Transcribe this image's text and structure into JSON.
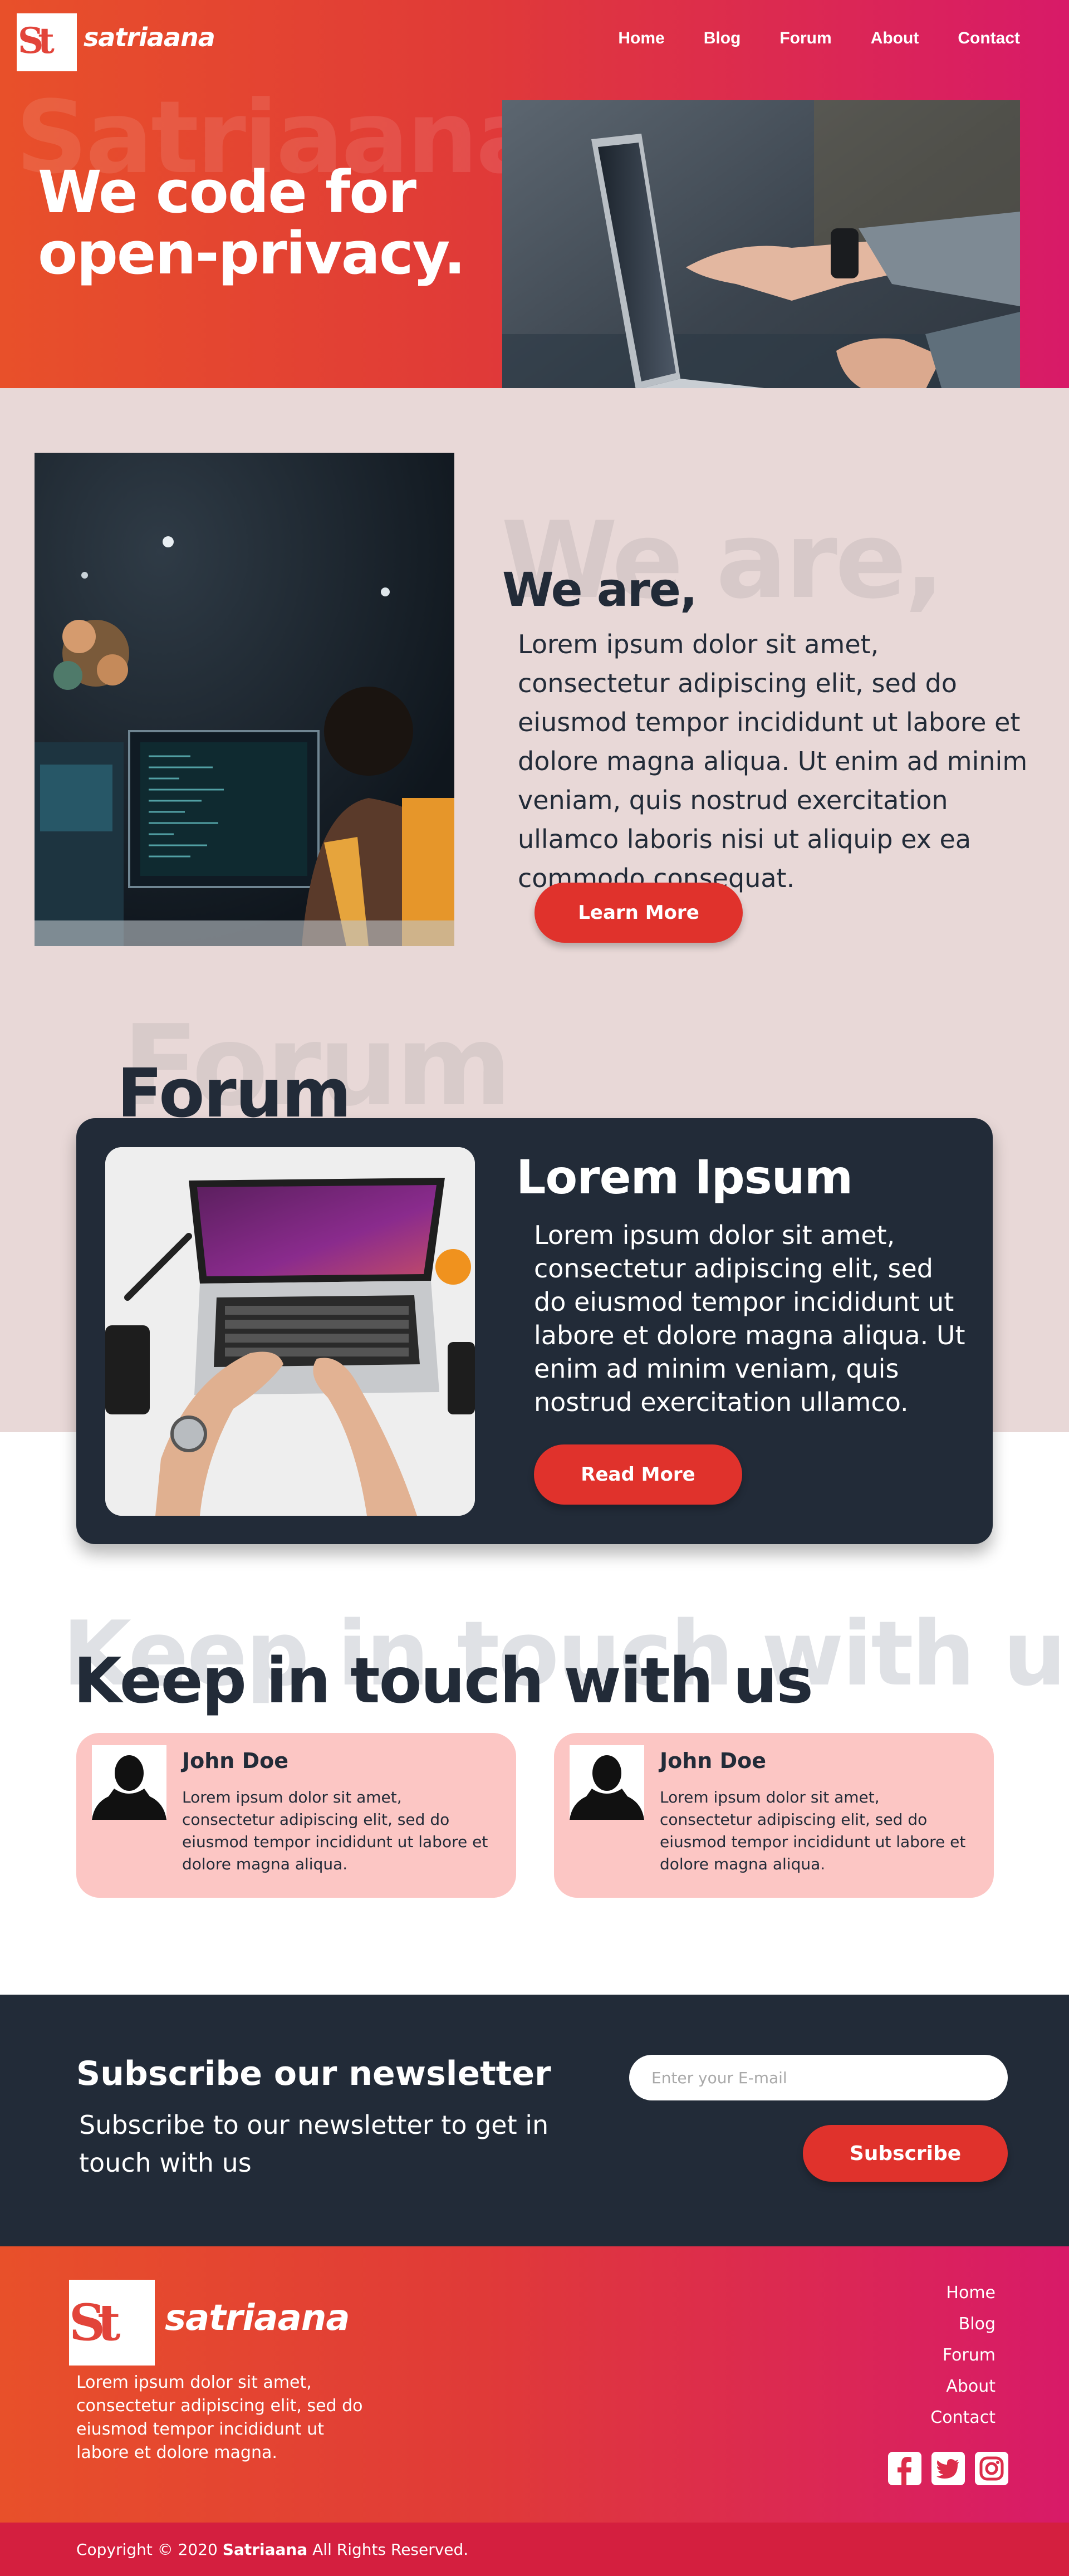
{
  "brand": {
    "name": "satriaana",
    "glyph": "St"
  },
  "nav": {
    "items": [
      "Home",
      "Blog",
      "Forum",
      "About",
      "Contact"
    ]
  },
  "hero": {
    "watermark": "Satriaana",
    "title_line1": "We code for",
    "title_line2": "open-privacy."
  },
  "about": {
    "watermark": "We are,",
    "title": "We are,",
    "text": "Lorem ipsum dolor sit amet, consectetur adipiscing elit, sed do eiusmod tempor incididunt ut labore et dolore magna aliqua. Ut enim ad minim veniam, quis nostrud exercitation ullamco laboris nisi ut aliquip ex ea commodo consequat.",
    "button": "Learn More"
  },
  "forum": {
    "watermark": "Forum",
    "title": "Forum",
    "card_title": "Lorem Ipsum",
    "card_text": "Lorem ipsum dolor sit amet, consectetur adipiscing elit, sed do eiusmod tempor incididunt ut labore et dolore magna aliqua. Ut enim ad minim veniam, quis nostrud exercitation ullamco.",
    "button": "Read More"
  },
  "contact": {
    "watermark": "Keep in touch with us",
    "title": "Keep in touch with us",
    "testimonials": [
      {
        "name": "John Doe",
        "text": "Lorem ipsum dolor sit amet, consectetur adipiscing elit, sed do eiusmod tempor incididunt ut labore et dolore magna aliqua."
      },
      {
        "name": "John Doe",
        "text": "Lorem ipsum dolor sit amet, consectetur adipiscing elit, sed do eiusmod tempor incididunt ut labore et dolore magna aliqua."
      }
    ]
  },
  "newsletter": {
    "title": "Subscribe our newsletter",
    "text": "Subscribe to our newsletter to get in touch with us",
    "placeholder": "Enter your E-mail",
    "button": "Subscribe"
  },
  "footer": {
    "text": "Lorem ipsum dolor sit amet, consectetur adipiscing elit, sed do eiusmod tempor incididunt ut labore et dolore magna.",
    "links": [
      "Home",
      "Blog",
      "Forum",
      "About",
      "Contact"
    ],
    "social_icons": [
      "facebook-icon",
      "twitter-icon",
      "instagram-icon"
    ],
    "copyright_prefix": "Copyright © 2020",
    "copyright_brand": "Satriaana",
    "copyright_suffix": "All Rights Reserved."
  },
  "colors": {
    "gradient_start": "#e8502a",
    "gradient_end": "#d81a68",
    "accent_red": "#e0322c",
    "navy": "#222b38",
    "blush": "#e8d8d7",
    "card_pink": "#fcc6c4"
  }
}
